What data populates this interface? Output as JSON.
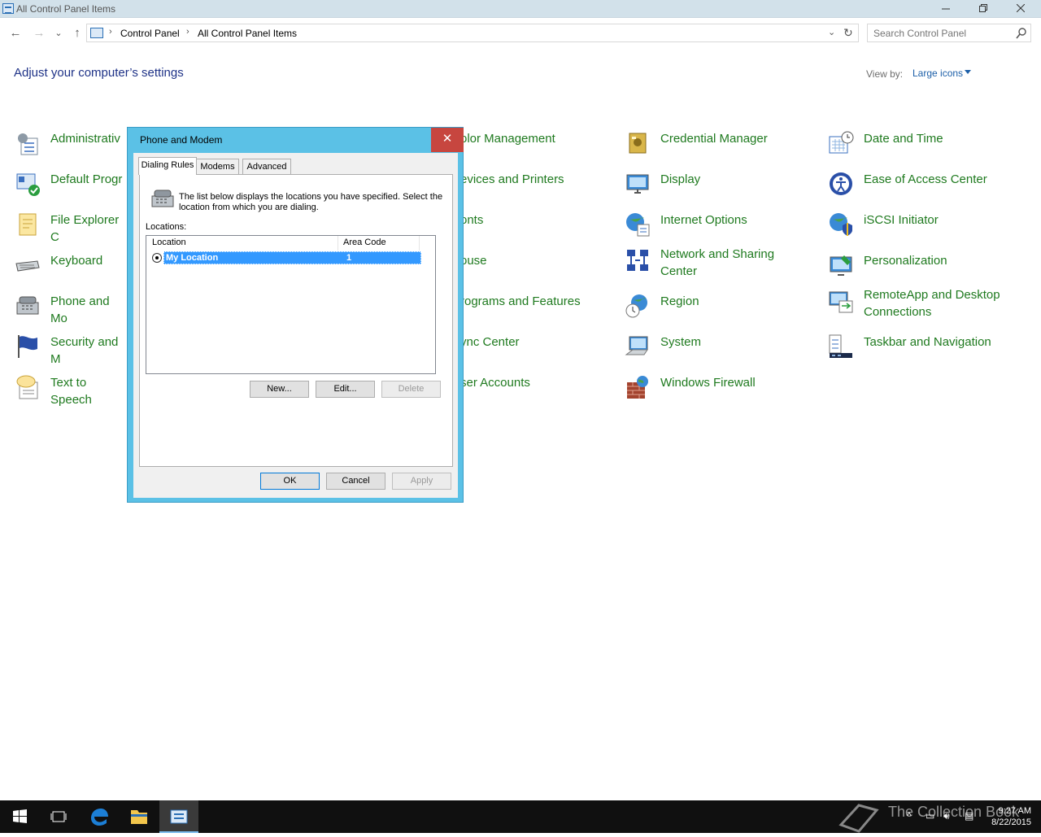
{
  "window": {
    "title": "All Control Panel Items",
    "min_icon": "minimize-icon",
    "max_icon": "restore-icon",
    "close_icon": "close-icon"
  },
  "navigation": {
    "back_icon": "←",
    "forward_icon": "→",
    "recent_icon": "⌄",
    "up_icon": "↑",
    "breadcrumb": [
      "Control Panel",
      "All Control Panel Items"
    ],
    "search_placeholder": "Search Control Panel"
  },
  "header": {
    "title": "Adjust your computer’s settings",
    "view_by_label": "View by:",
    "view_by_value": "Large icons"
  },
  "items": [
    {
      "label": "Administrativ",
      "icon": "admin-tools-icon"
    },
    {
      "label": "Default Progr",
      "icon": "default-programs-icon"
    },
    {
      "label": "File Explorer C",
      "icon": "file-explorer-options-icon"
    },
    {
      "label": "Keyboard",
      "icon": "keyboard-icon"
    },
    {
      "label": "Phone and Mo",
      "icon": "phone-modem-icon"
    },
    {
      "label": "Security and M",
      "icon": "security-maintenance-icon"
    },
    {
      "label": "Text to Speech",
      "icon": "text-to-speech-icon"
    },
    {
      "label": "olor Management",
      "icon": "color-management-icon"
    },
    {
      "label": "evices and Printers",
      "icon": "devices-printers-icon"
    },
    {
      "label": "onts",
      "icon": "fonts-icon"
    },
    {
      "label": "ouse",
      "icon": "mouse-icon"
    },
    {
      "label": "rograms and Features",
      "icon": "programs-features-icon"
    },
    {
      "label": "ync Center",
      "icon": "sync-center-icon"
    },
    {
      "label": "ser Accounts",
      "icon": "user-accounts-icon"
    },
    {
      "label": "Credential Manager",
      "icon": "credential-manager-icon"
    },
    {
      "label": "Display",
      "icon": "display-icon"
    },
    {
      "label": "Internet Options",
      "icon": "internet-options-icon"
    },
    {
      "label": "Network and Sharing Center",
      "icon": "network-sharing-icon"
    },
    {
      "label": "Region",
      "icon": "region-icon"
    },
    {
      "label": "System",
      "icon": "system-icon"
    },
    {
      "label": "Windows Firewall",
      "icon": "firewall-icon"
    },
    {
      "label": "Date and Time",
      "icon": "date-time-icon"
    },
    {
      "label": "Ease of Access Center",
      "icon": "ease-of-access-icon"
    },
    {
      "label": "iSCSI Initiator",
      "icon": "iscsi-initiator-icon"
    },
    {
      "label": "Personalization",
      "icon": "personalization-icon"
    },
    {
      "label": "RemoteApp and Desktop Connections",
      "icon": "remoteapp-icon"
    },
    {
      "label": "Taskbar and Navigation",
      "icon": "taskbar-navigation-icon"
    }
  ],
  "dialog": {
    "title": "Phone and Modem",
    "close": "✕",
    "tabs": [
      "Dialing Rules",
      "Modems",
      "Advanced"
    ],
    "description": "The list below displays the locations you have specified. Select the location from which you are dialing.",
    "locations_label": "Locations:",
    "columns": [
      "Location",
      "Area Code"
    ],
    "rows": [
      {
        "location": "My Location",
        "area_code": "1"
      }
    ],
    "buttons": {
      "new": "New...",
      "edit": "Edit...",
      "delete": "Delete",
      "ok": "OK",
      "cancel": "Cancel",
      "apply": "Apply"
    }
  },
  "taskbar": {
    "time": "9:27 AM",
    "date": "8/22/2015",
    "watermark": "The Collection Book"
  }
}
